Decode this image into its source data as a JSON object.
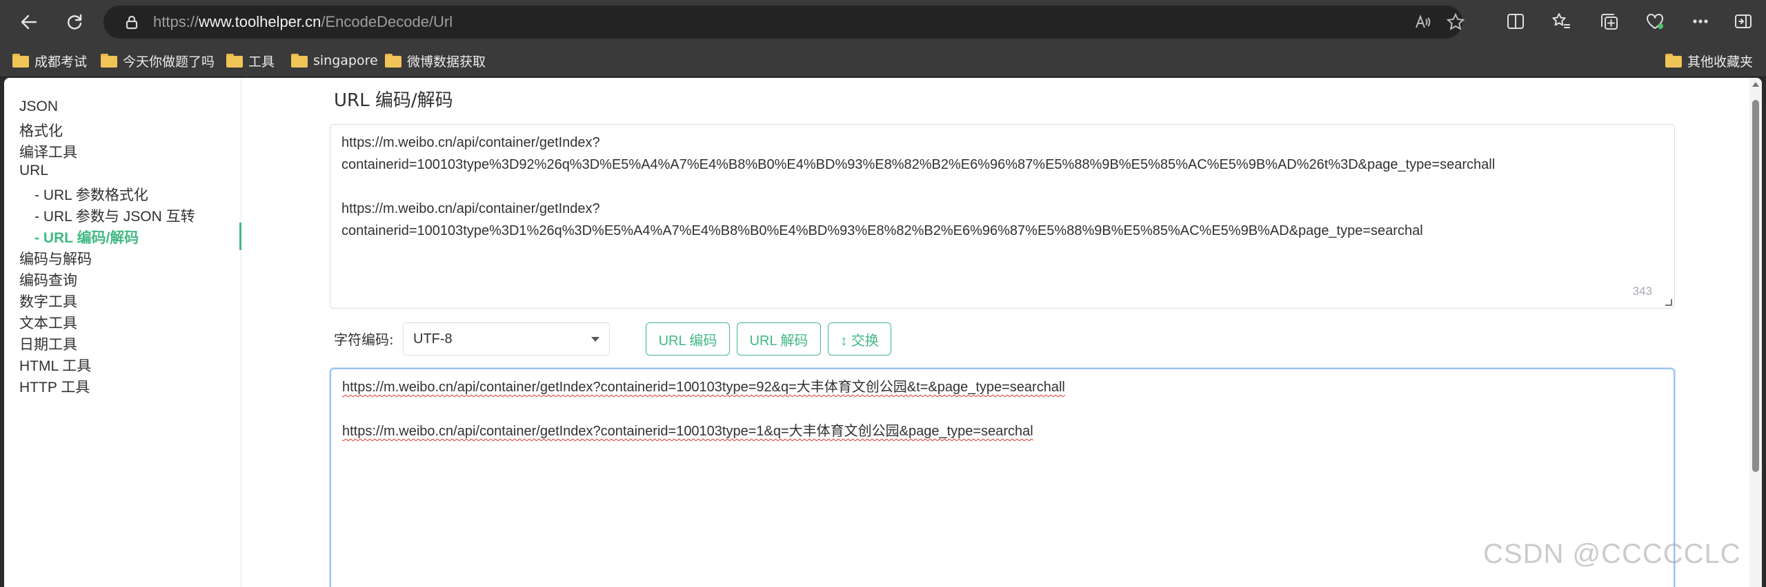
{
  "browser": {
    "url_prefix": "https://",
    "url_host": "www.toolhelper.cn",
    "url_path": "/EncodeDecode/Url"
  },
  "bookmarks": [
    {
      "label": "成都考试"
    },
    {
      "label": "今天你做题了吗"
    },
    {
      "label": "工具"
    },
    {
      "label": "singapore"
    },
    {
      "label": "微博数据获取"
    },
    {
      "label": "其他收藏夹"
    }
  ],
  "sidebar": {
    "items": [
      {
        "label": "JSON"
      },
      {
        "label": "格式化"
      },
      {
        "label": "编译工具"
      },
      {
        "label": "URL"
      },
      {
        "label": "- URL 参数格式化"
      },
      {
        "label": "- URL 参数与 JSON 互转"
      },
      {
        "label": "- URL  编码/解码"
      },
      {
        "label": "编码与解码"
      },
      {
        "label": "编码查询"
      },
      {
        "label": "数字工具"
      },
      {
        "label": "文本工具"
      },
      {
        "label": "日期工具"
      },
      {
        "label": "HTML 工具"
      },
      {
        "label": "HTTP 工具"
      }
    ]
  },
  "main": {
    "title": "URL 编码/解码",
    "input": {
      "lines": [
        "https://m.weibo.cn/api/container/getIndex?",
        "containerid=100103type%3D92%26q%3D%E5%A4%A7%E4%B8%B0%E4%BD%93%E8%82%B2%E6%96%87%E5%88%9B%E5%85%AC%E5%9B%AD%26t%3D&page_type=searchall",
        "",
        "https://m.weibo.cn/api/container/getIndex?",
        "containerid=100103type%3D1%26q%3D%E5%A4%A7%E4%B8%B0%E4%BD%93%E8%82%B2%E6%96%87%E5%88%9B%E5%85%AC%E5%9B%AD&page_type=searchal"
      ],
      "char_count": "343"
    },
    "charset_label": "字符编码:",
    "charset_value": "UTF-8",
    "buttons": {
      "encode": "URL 编码",
      "decode": "URL 解码",
      "swap": "↕ 交换"
    },
    "output": {
      "line1": "https://m.weibo.cn/api/container/getIndex?containerid=100103type=92&q=大丰体育文创公园&t=&page_type=searchall",
      "line2": "https://m.weibo.cn/api/container/getIndex?containerid=100103type=1&q=大丰体育文创公园&page_type=searchal"
    }
  },
  "watermark": "CSDN @CCCCCLC"
}
